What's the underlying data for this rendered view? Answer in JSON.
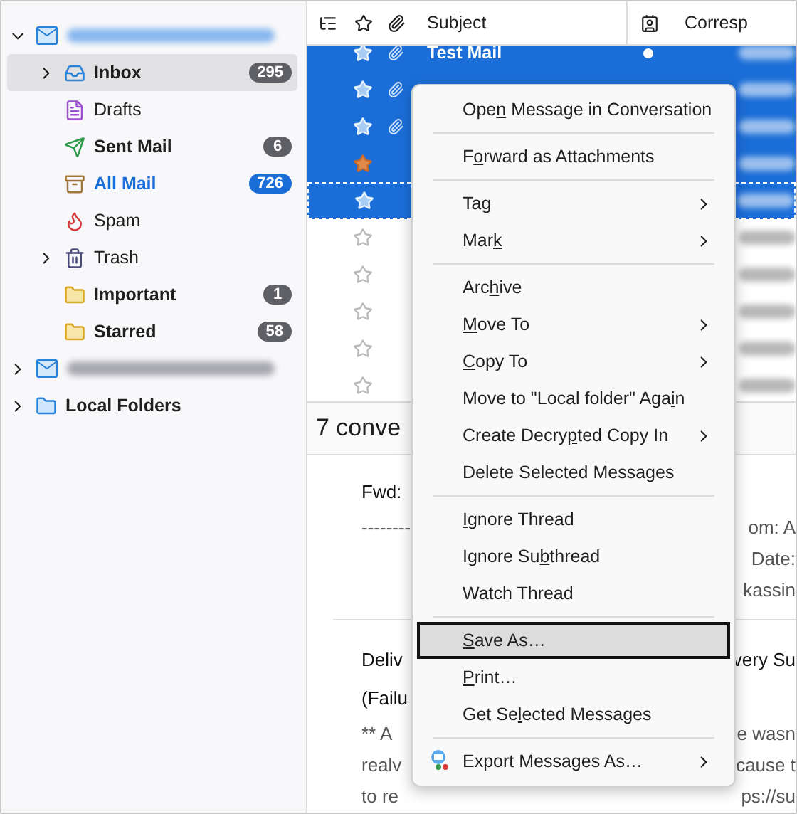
{
  "folder_tree": [
    {
      "kind": "account",
      "expanded": true,
      "selected": false,
      "children": [
        {
          "kind": "inbox",
          "label": "Inbox",
          "bold": true,
          "count": "295",
          "color": "#5f5f66",
          "selected": true,
          "expandable": true,
          "highlighted": false
        },
        {
          "kind": "drafts",
          "label": "Drafts",
          "bold": false,
          "selected": false,
          "expandable": false,
          "highlighted": false
        },
        {
          "kind": "sent",
          "label": "Sent Mail",
          "bold": true,
          "count": "6",
          "color": "#5f5f66",
          "selected": false,
          "expandable": false,
          "highlighted": false
        },
        {
          "kind": "archive",
          "label": "All Mail",
          "bold": true,
          "count": "726",
          "color": "#1b6ed8",
          "selected": false,
          "expandable": false,
          "highlighted": true
        },
        {
          "kind": "spam",
          "label": "Spam",
          "bold": false,
          "selected": false,
          "expandable": false,
          "highlighted": false
        },
        {
          "kind": "trash",
          "label": "Trash",
          "bold": false,
          "selected": false,
          "expandable": true,
          "highlighted": false
        },
        {
          "kind": "folder",
          "label": "Important",
          "bold": true,
          "count": "1",
          "color": "#5f5f66",
          "selected": false,
          "expandable": false,
          "highlighted": false
        },
        {
          "kind": "folder",
          "label": "Starred",
          "bold": true,
          "count": "58",
          "color": "#5f5f66",
          "selected": false,
          "expandable": false,
          "highlighted": false
        }
      ]
    },
    {
      "kind": "account",
      "expanded": false,
      "selected": false
    },
    {
      "kind": "local",
      "expanded": false,
      "selected": false,
      "label": "Local Folders"
    }
  ],
  "message_list": {
    "columns": [
      {
        "kind": "thread"
      },
      {
        "kind": "star"
      },
      {
        "kind": "attachment"
      },
      {
        "kind": "text",
        "label": "Subject"
      },
      {
        "kind": "picker"
      },
      {
        "kind": "text",
        "label": "Corresp"
      }
    ],
    "rows": [
      {
        "subject": "Test Mail",
        "selected": true,
        "starred": false,
        "attachment": true,
        "focused": false,
        "read_dot": true
      },
      {
        "selected": true,
        "starred": false,
        "attachment": true,
        "focused": false,
        "read_dot": false
      },
      {
        "selected": true,
        "starred": false,
        "attachment": true,
        "focused": false,
        "read_dot": false
      },
      {
        "selected": true,
        "starred": true,
        "attachment": false,
        "focused": false,
        "read_dot": false
      },
      {
        "selected": true,
        "starred": false,
        "attachment": false,
        "focused": true,
        "read_dot": false
      },
      {
        "selected": false,
        "starred": false,
        "attachment": false,
        "focused": false,
        "read_dot": false
      },
      {
        "selected": false,
        "starred": false,
        "attachment": false,
        "focused": false,
        "read_dot": false
      },
      {
        "selected": false,
        "starred": false,
        "attachment": false,
        "focused": false,
        "read_dot": false
      },
      {
        "selected": false,
        "starred": false,
        "attachment": false,
        "focused": false,
        "read_dot": false
      },
      {
        "selected": false,
        "starred": false,
        "attachment": false,
        "focused": false,
        "read_dot": false
      }
    ]
  },
  "summary": {
    "title": "7 conve",
    "lines": [
      {
        "kind": "subject",
        "left": "Fwd:"
      },
      {
        "kind": "body",
        "left": "--------",
        "right": "om: A"
      },
      {
        "kind": "body",
        "right": "Date:"
      },
      {
        "kind": "body",
        "right": "kassin"
      },
      {
        "kind": "divider"
      },
      {
        "kind": "subject",
        "left": "Deliv",
        "right": "very Su"
      },
      {
        "kind": "subject",
        "left": "(Failu"
      },
      {
        "kind": "body",
        "left": "** A",
        "right": "e wasn"
      },
      {
        "kind": "body",
        "left": "realv",
        "right": "cause t"
      },
      {
        "kind": "body",
        "left": "to re",
        "right": "ps://su"
      }
    ]
  },
  "context_menu": [
    {
      "kind": "item",
      "before": "Ope",
      "key": "n",
      "after": " Message in Conversation",
      "submenu": false,
      "selected": false
    },
    {
      "kind": "separator"
    },
    {
      "kind": "item",
      "before": "F",
      "key": "o",
      "after": "rward as Attachments",
      "submenu": false,
      "selected": false
    },
    {
      "kind": "separator"
    },
    {
      "kind": "item",
      "before": "Tag",
      "submenu": true,
      "selected": false
    },
    {
      "kind": "item",
      "before": "Mar",
      "key": "k",
      "submenu": true,
      "selected": false
    },
    {
      "kind": "separator"
    },
    {
      "kind": "item",
      "before": "Arc",
      "key": "h",
      "after": "ive",
      "submenu": false,
      "selected": false
    },
    {
      "kind": "item",
      "key": "M",
      "after": "ove To",
      "submenu": true,
      "selected": false
    },
    {
      "kind": "item",
      "key": "C",
      "after": "opy To",
      "submenu": true,
      "selected": false
    },
    {
      "kind": "item",
      "before": "Move to \"Local folder\" Aga",
      "key": "i",
      "after": "n",
      "submenu": false,
      "selected": false
    },
    {
      "kind": "item",
      "before": "Create Decry",
      "key": "p",
      "after": "ted Copy In",
      "submenu": true,
      "selected": false
    },
    {
      "kind": "item",
      "before": "Delete Selected Messages",
      "submenu": false,
      "selected": false
    },
    {
      "kind": "separator"
    },
    {
      "kind": "item",
      "key": "I",
      "after": "gnore Thread",
      "submenu": false,
      "selected": false
    },
    {
      "kind": "item",
      "before": "Ignore Su",
      "key": "b",
      "after": "thread",
      "submenu": false,
      "selected": false
    },
    {
      "kind": "item",
      "before": "Watch Thread",
      "submenu": false,
      "selected": false
    },
    {
      "kind": "separator"
    },
    {
      "kind": "item",
      "key": "S",
      "after": "ave As…",
      "submenu": false,
      "selected": true
    },
    {
      "kind": "item",
      "key": "P",
      "after": "rint…",
      "submenu": false,
      "selected": false
    },
    {
      "kind": "item",
      "before": "Get Se",
      "key": "l",
      "after": "ected Messages",
      "submenu": false,
      "selected": false
    },
    {
      "kind": "separator"
    },
    {
      "kind": "export",
      "before": "Export Messages As…",
      "submenu": true,
      "selected": false
    }
  ]
}
